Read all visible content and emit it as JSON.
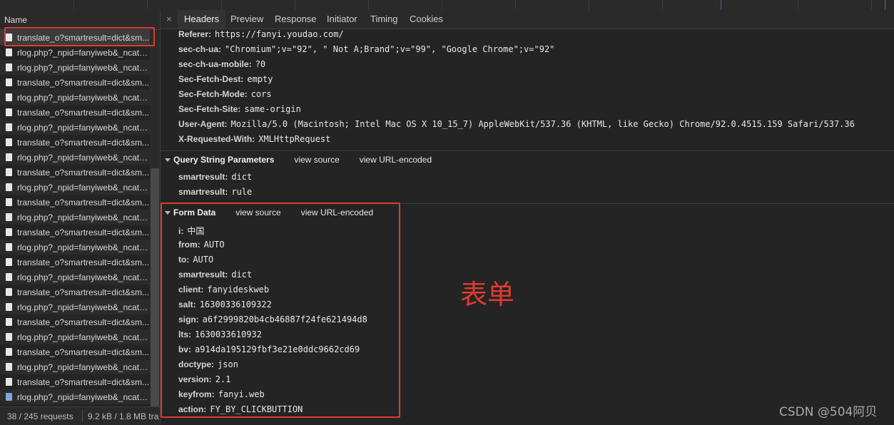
{
  "left": {
    "column_header": "Name",
    "requests": [
      {
        "name": "translate_o?smartresult=dict&sm...",
        "icon": "file-icon"
      },
      {
        "name": "rlog.php?_npid=fanyiweb&_ncat=...",
        "icon": "file-icon"
      },
      {
        "name": "rlog.php?_npid=fanyiweb&_ncat=...",
        "icon": "file-icon"
      },
      {
        "name": "translate_o?smartresult=dict&sm...",
        "icon": "file-icon"
      },
      {
        "name": "rlog.php?_npid=fanyiweb&_ncat=...",
        "icon": "file-icon"
      },
      {
        "name": "translate_o?smartresult=dict&sm...",
        "icon": "file-icon"
      },
      {
        "name": "rlog.php?_npid=fanyiweb&_ncat=...",
        "icon": "file-icon"
      },
      {
        "name": "translate_o?smartresult=dict&sm...",
        "icon": "file-icon"
      },
      {
        "name": "rlog.php?_npid=fanyiweb&_ncat=...",
        "icon": "file-icon"
      },
      {
        "name": "translate_o?smartresult=dict&sm...",
        "icon": "file-icon"
      },
      {
        "name": "rlog.php?_npid=fanyiweb&_ncat=...",
        "icon": "file-icon"
      },
      {
        "name": "translate_o?smartresult=dict&sm...",
        "icon": "file-icon"
      },
      {
        "name": "rlog.php?_npid=fanyiweb&_ncat=...",
        "icon": "file-icon"
      },
      {
        "name": "translate_o?smartresult=dict&sm...",
        "icon": "file-icon"
      },
      {
        "name": "rlog.php?_npid=fanyiweb&_ncat=...",
        "icon": "file-icon"
      },
      {
        "name": "translate_o?smartresult=dict&sm...",
        "icon": "file-icon"
      },
      {
        "name": "rlog.php?_npid=fanyiweb&_ncat=...",
        "icon": "file-icon"
      },
      {
        "name": "translate_o?smartresult=dict&sm...",
        "icon": "file-icon"
      },
      {
        "name": "rlog.php?_npid=fanyiweb&_ncat=...",
        "icon": "file-icon"
      },
      {
        "name": "translate_o?smartresult=dict&sm...",
        "icon": "file-icon"
      },
      {
        "name": "rlog.php?_npid=fanyiweb&_ncat=...",
        "icon": "file-icon"
      },
      {
        "name": "translate_o?smartresult=dict&sm...",
        "icon": "file-icon"
      },
      {
        "name": "rlog.php?_npid=fanyiweb&_ncat=...",
        "icon": "file-icon"
      },
      {
        "name": "translate_o?smartresult=dict&sm...",
        "icon": "file-icon"
      },
      {
        "name": "rlog.php?_npid=fanyiweb&_ncat=...",
        "icon": "image-file-icon"
      }
    ],
    "status": {
      "requests": "38 / 245 requests",
      "transferred": "9.2 kB / 1.8 MB tra"
    }
  },
  "tabs": {
    "close_label": "×",
    "items": [
      "Headers",
      "Preview",
      "Response",
      "Initiator",
      "Timing",
      "Cookies"
    ],
    "active": "Headers"
  },
  "request_headers": [
    {
      "key": "Referer:",
      "value": "https://fanyi.youdao.com/"
    },
    {
      "key": "sec-ch-ua:",
      "value": "\"Chromium\";v=\"92\", \" Not A;Brand\";v=\"99\", \"Google Chrome\";v=\"92\""
    },
    {
      "key": "sec-ch-ua-mobile:",
      "value": "?0"
    },
    {
      "key": "Sec-Fetch-Dest:",
      "value": "empty"
    },
    {
      "key": "Sec-Fetch-Mode:",
      "value": "cors"
    },
    {
      "key": "Sec-Fetch-Site:",
      "value": "same-origin"
    },
    {
      "key": "User-Agent:",
      "value": "Mozilla/5.0 (Macintosh; Intel Mac OS X 10_15_7) AppleWebKit/537.36 (KHTML, like Gecko) Chrome/92.0.4515.159 Safari/537.36"
    },
    {
      "key": "X-Requested-With:",
      "value": "XMLHttpRequest"
    }
  ],
  "query_params": {
    "title": "Query String Parameters",
    "view_source": "view source",
    "view_url_encoded": "view URL-encoded",
    "items": [
      {
        "key": "smartresult:",
        "value": "dict"
      },
      {
        "key": "smartresult:",
        "value": "rule"
      }
    ]
  },
  "form_data": {
    "title": "Form Data",
    "view_source": "view source",
    "view_url_encoded": "view URL-encoded",
    "items": [
      {
        "key": "i:",
        "value": "中国"
      },
      {
        "key": "from:",
        "value": "AUTO"
      },
      {
        "key": "to:",
        "value": "AUTO"
      },
      {
        "key": "smartresult:",
        "value": "dict"
      },
      {
        "key": "client:",
        "value": "fanyideskweb"
      },
      {
        "key": "salt:",
        "value": "16300336109322"
      },
      {
        "key": "sign:",
        "value": "a6f2999820b4cb46887f24fe621494d8"
      },
      {
        "key": "lts:",
        "value": "1630033610932"
      },
      {
        "key": "bv:",
        "value": "a914da195129fbf3e21e0ddc9662cd69"
      },
      {
        "key": "doctype:",
        "value": "json"
      },
      {
        "key": "version:",
        "value": "2.1"
      },
      {
        "key": "keyfrom:",
        "value": "fanyi.web"
      },
      {
        "key": "action:",
        "value": "FY_BY_CLICKBUTTION"
      }
    ]
  },
  "annotation": "表单",
  "watermark": "CSDN @504阿贝",
  "colors": {
    "highlight": "#e03a2f"
  }
}
